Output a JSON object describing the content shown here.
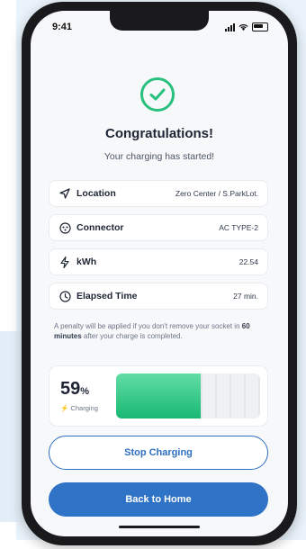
{
  "status_bar": {
    "time": "9:41"
  },
  "header": {
    "title": "Congratulations!",
    "subtitle": "Your charging has started!"
  },
  "details": [
    {
      "label": "Location",
      "value": "Zero Center / S.ParkLot.",
      "icon": "location-arrow-icon"
    },
    {
      "label": "Connector",
      "value": "AC TYPE-2",
      "icon": "connector-icon"
    },
    {
      "label": "kWh",
      "value": "22.54",
      "icon": "bolt-icon"
    },
    {
      "label": "Elapsed Time",
      "value": "27 min.",
      "icon": "clock-icon"
    }
  ],
  "note": {
    "before": "A penalty will be applied if you don't remove your socket in ",
    "emphasis": "60 minutes",
    "after": " after your charge is completed."
  },
  "charge": {
    "percent": "59",
    "unit": "%",
    "status": "Charging",
    "level": 0.59
  },
  "buttons": {
    "stop": "Stop Charging",
    "home": "Back to Home"
  },
  "colors": {
    "accent_green": "#27c07d",
    "primary_blue": "#2f73c6"
  }
}
